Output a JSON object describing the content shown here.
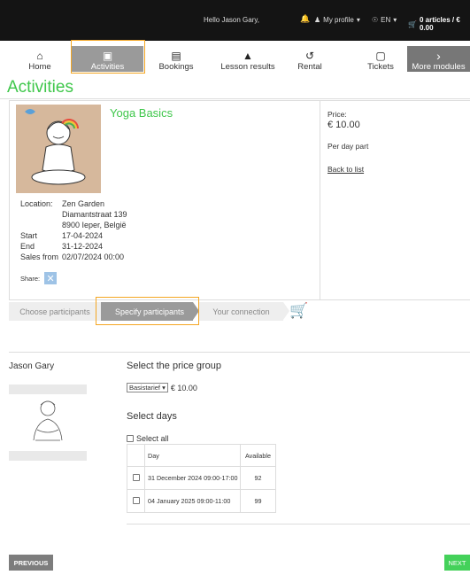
{
  "topbar": {
    "greeting": "Hello Jason Gary,",
    "profile_label": "My profile",
    "language": "EN",
    "cart_label": "0 articles / € 0.00"
  },
  "nav": {
    "items": [
      {
        "label": "Home",
        "icon": "home-icon"
      },
      {
        "label": "Activities",
        "icon": "calendar-icon",
        "active": true
      },
      {
        "label": "Bookings",
        "icon": "clipboard-icon"
      },
      {
        "label": "Lesson results",
        "icon": "graduation-cap-icon"
      },
      {
        "label": "Rental",
        "icon": "history-icon"
      },
      {
        "label": "Tickets",
        "icon": "ticket-icon"
      },
      {
        "label": "More modules",
        "icon": "chevron-right-icon"
      }
    ]
  },
  "page": {
    "title": "Activities"
  },
  "activity": {
    "title": "Yoga Basics",
    "location_label": "Location:",
    "location_lines": [
      "Zen Garden",
      "Diamantstraat 139",
      "8900 Ieper, België"
    ],
    "start_label": "Start",
    "start": "17-04-2024",
    "end_label": "End",
    "end": "31-12-2024",
    "sales_label": "Sales from",
    "sales_from": "02/07/2024 00:00",
    "share_label": "Share:",
    "price_label": "Price:",
    "price": "€ 10.00",
    "price_unit": "Per day part",
    "back_label": "Back to list"
  },
  "steps": [
    {
      "label": "Choose participants",
      "active": false
    },
    {
      "label": "Specify participants",
      "active": true
    },
    {
      "label": "Your connection",
      "active": false
    }
  ],
  "participant": {
    "name": "Jason Gary",
    "price_group_title": "Select the price group",
    "price_group_option": "Basistarief",
    "price_group_value": "€ 10.00",
    "days_title": "Select days",
    "select_all_label": "Select all",
    "table": {
      "headers": [
        "Day",
        "Available"
      ],
      "rows": [
        {
          "day": "31 December 2024 09:00-17:00",
          "available": "92"
        },
        {
          "day": "04 January 2025 09:00-11:00",
          "available": "99"
        }
      ]
    }
  },
  "buttons": {
    "previous": "PREVIOUS",
    "next": "NEXT"
  },
  "colors": {
    "accent_green": "#3fc74b",
    "highlight": "#f4a623",
    "active_tab": "#9a9a9a"
  }
}
